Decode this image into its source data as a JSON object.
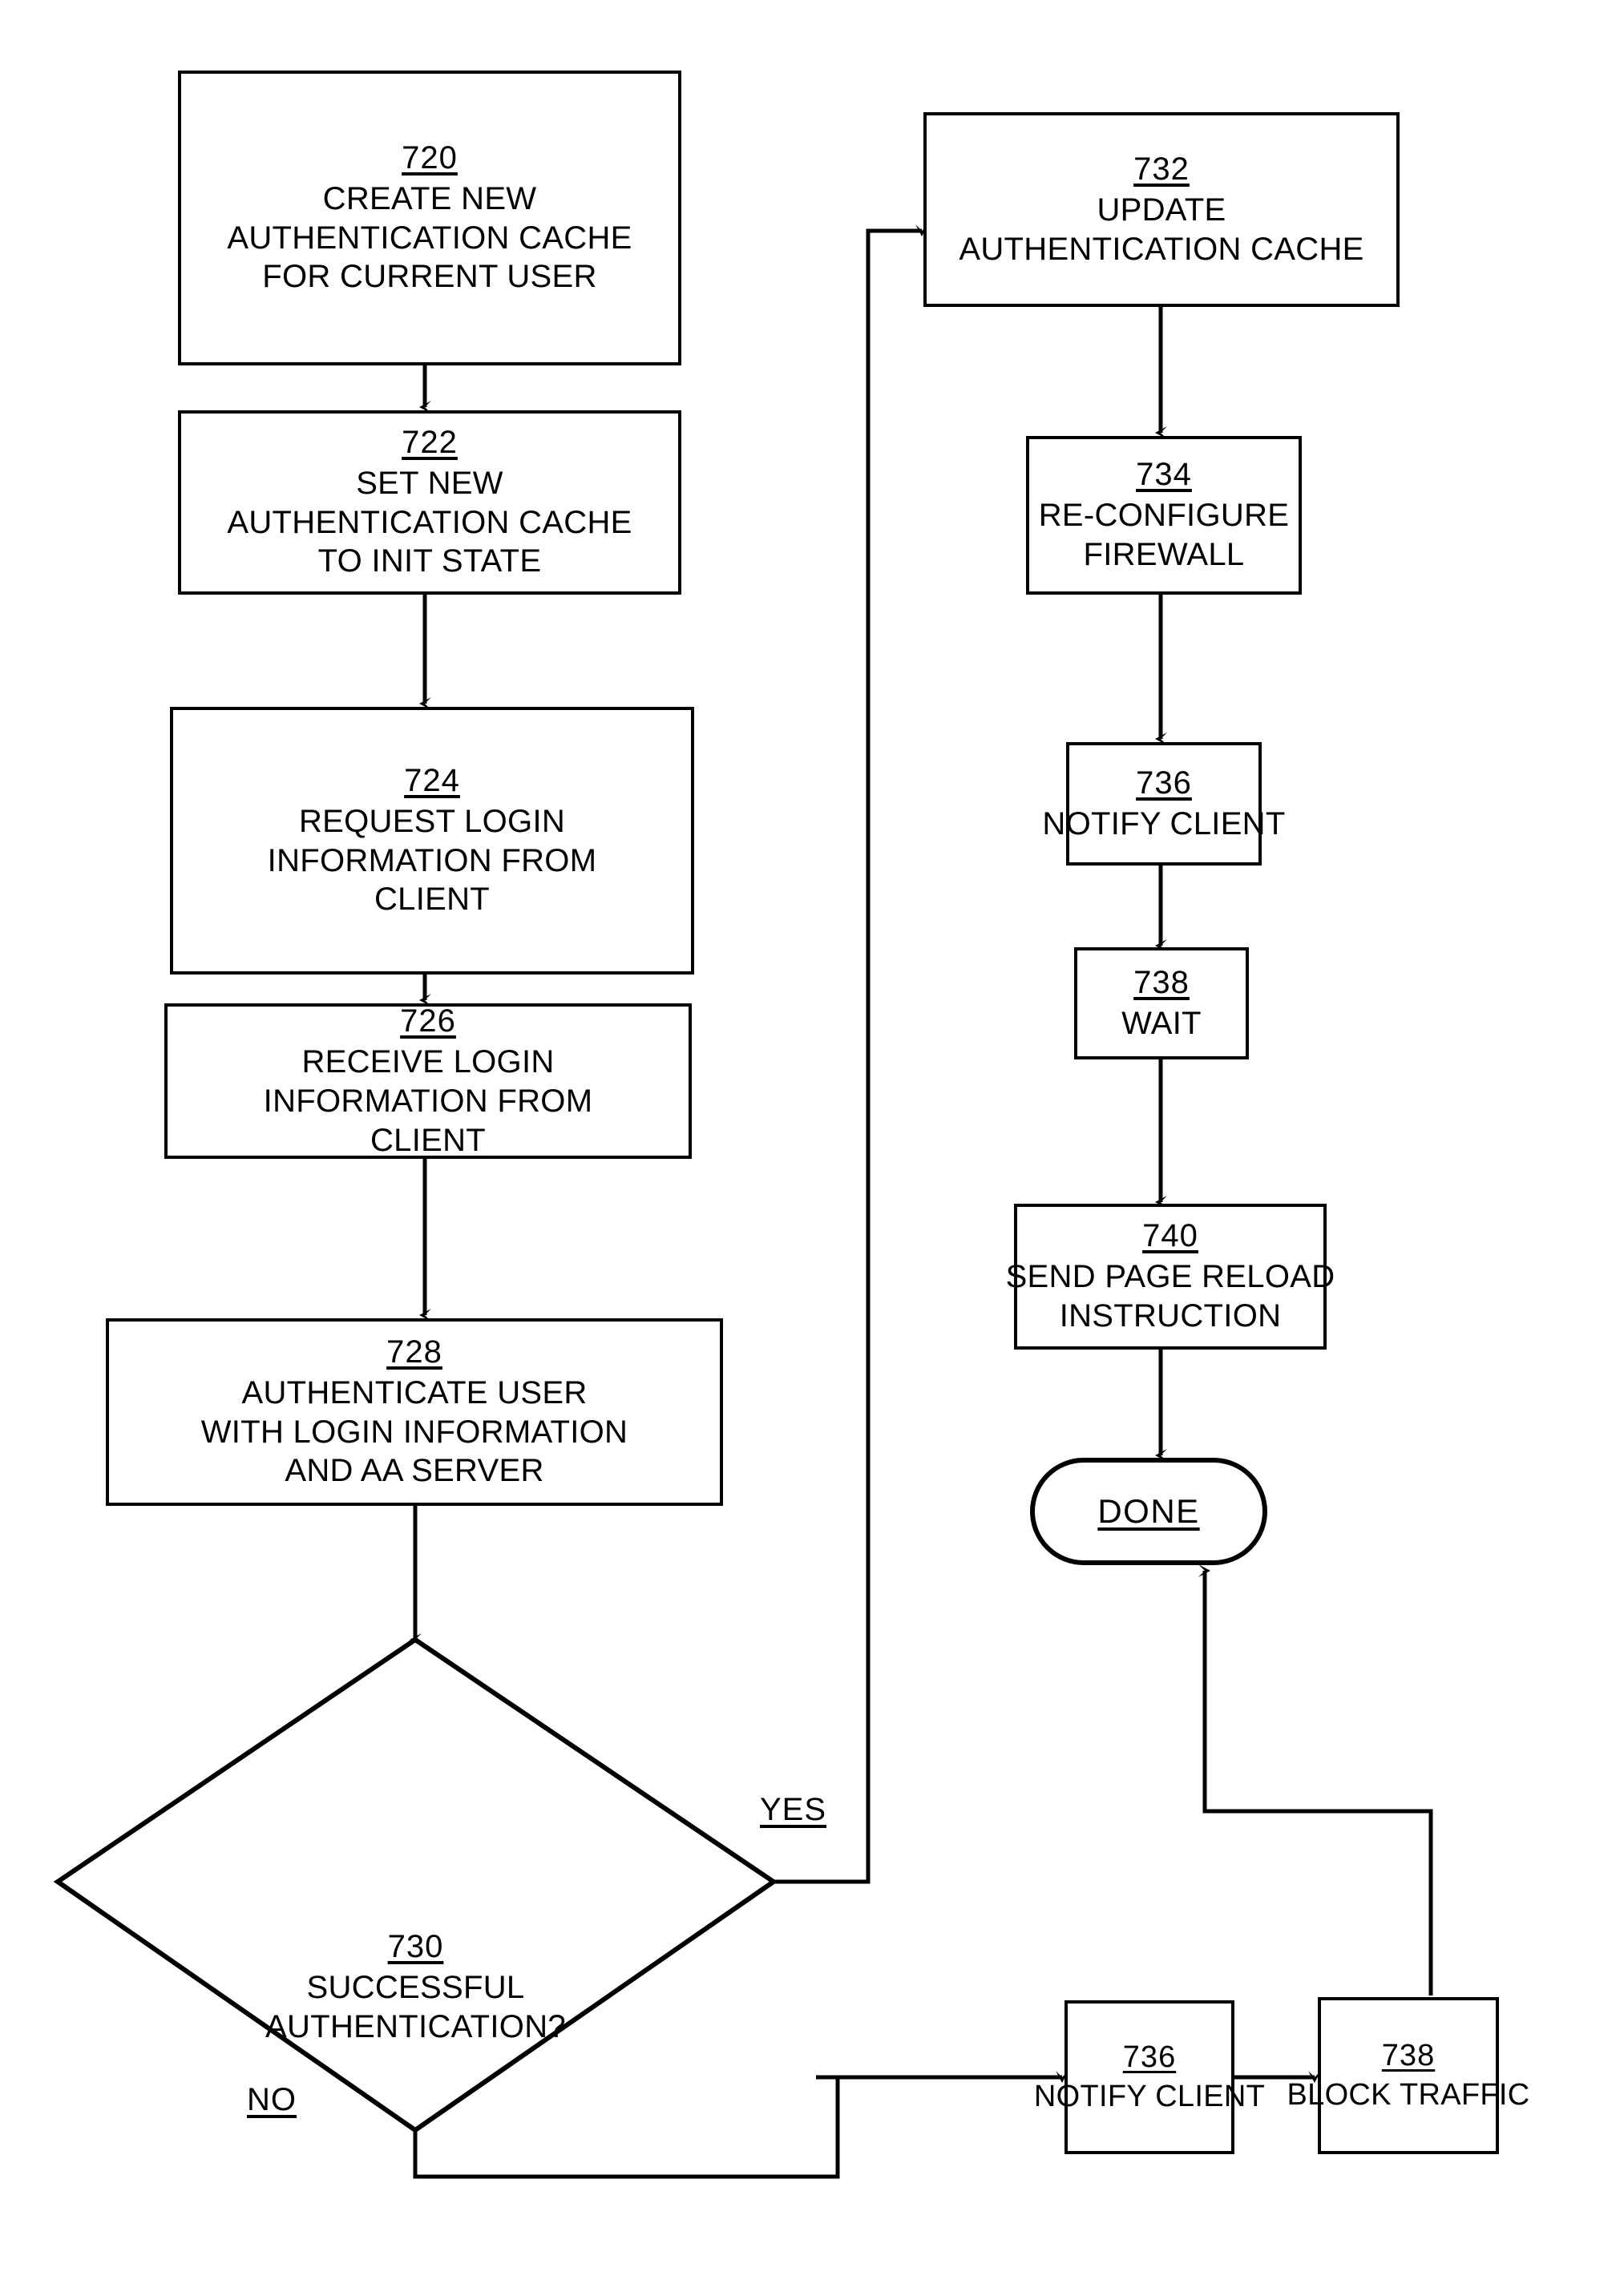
{
  "figure": {
    "kind": "patent-flowchart",
    "ink_color": "#000000",
    "background_color": "#ffffff"
  },
  "nodes": [
    {
      "id": "n720",
      "shape": "process",
      "number": "720",
      "lines": [
        "CREATE NEW",
        "AUTHENTICATION CACHE",
        "FOR CURRENT USER"
      ]
    },
    {
      "id": "n722",
      "shape": "process",
      "number": "722",
      "lines": [
        "SET NEW",
        "AUTHENTICATION CACHE",
        "TO INIT STATE"
      ]
    },
    {
      "id": "n724",
      "shape": "process",
      "number": "724",
      "lines": [
        "REQUEST LOGIN",
        "INFORMATION FROM",
        "CLIENT"
      ]
    },
    {
      "id": "n726",
      "shape": "process",
      "number": "726",
      "lines": [
        "RECEIVE LOGIN",
        "INFORMATION FROM",
        "CLIENT"
      ]
    },
    {
      "id": "n728",
      "shape": "process",
      "number": "728",
      "lines": [
        "AUTHENTICATE USER",
        "WITH LOGIN INFORMATION",
        "AND AA SERVER"
      ]
    },
    {
      "id": "n730",
      "shape": "decision",
      "number": "730",
      "lines": [
        "SUCCESSFUL",
        "AUTHENTICATION?"
      ]
    },
    {
      "id": "n732",
      "shape": "process",
      "number": "732",
      "lines": [
        "UPDATE",
        "AUTHENTICATION CACHE"
      ]
    },
    {
      "id": "n734",
      "shape": "process",
      "number": "734",
      "lines": [
        "RE-CONFIGURE",
        "FIREWALL"
      ]
    },
    {
      "id": "n736",
      "shape": "process",
      "number": "736",
      "lines": [
        "NOTIFY CLIENT"
      ]
    },
    {
      "id": "n738wait",
      "shape": "process",
      "number": "738",
      "lines": [
        "WAIT"
      ]
    },
    {
      "id": "n740",
      "shape": "process",
      "number": "740",
      "lines": [
        "SEND PAGE RELOAD",
        "INSTRUCTION"
      ]
    },
    {
      "id": "n736b",
      "shape": "process",
      "number": "736",
      "lines": [
        "NOTIFY CLIENT"
      ]
    },
    {
      "id": "n738block",
      "shape": "process",
      "number": "738",
      "lines": [
        "BLOCK TRAFFIC"
      ]
    },
    {
      "id": "done",
      "shape": "terminal",
      "number": "",
      "lines": [
        "DONE"
      ]
    }
  ],
  "edge_labels": {
    "yes": "YES",
    "no": "NO"
  },
  "terminal": {
    "done": "DONE"
  }
}
